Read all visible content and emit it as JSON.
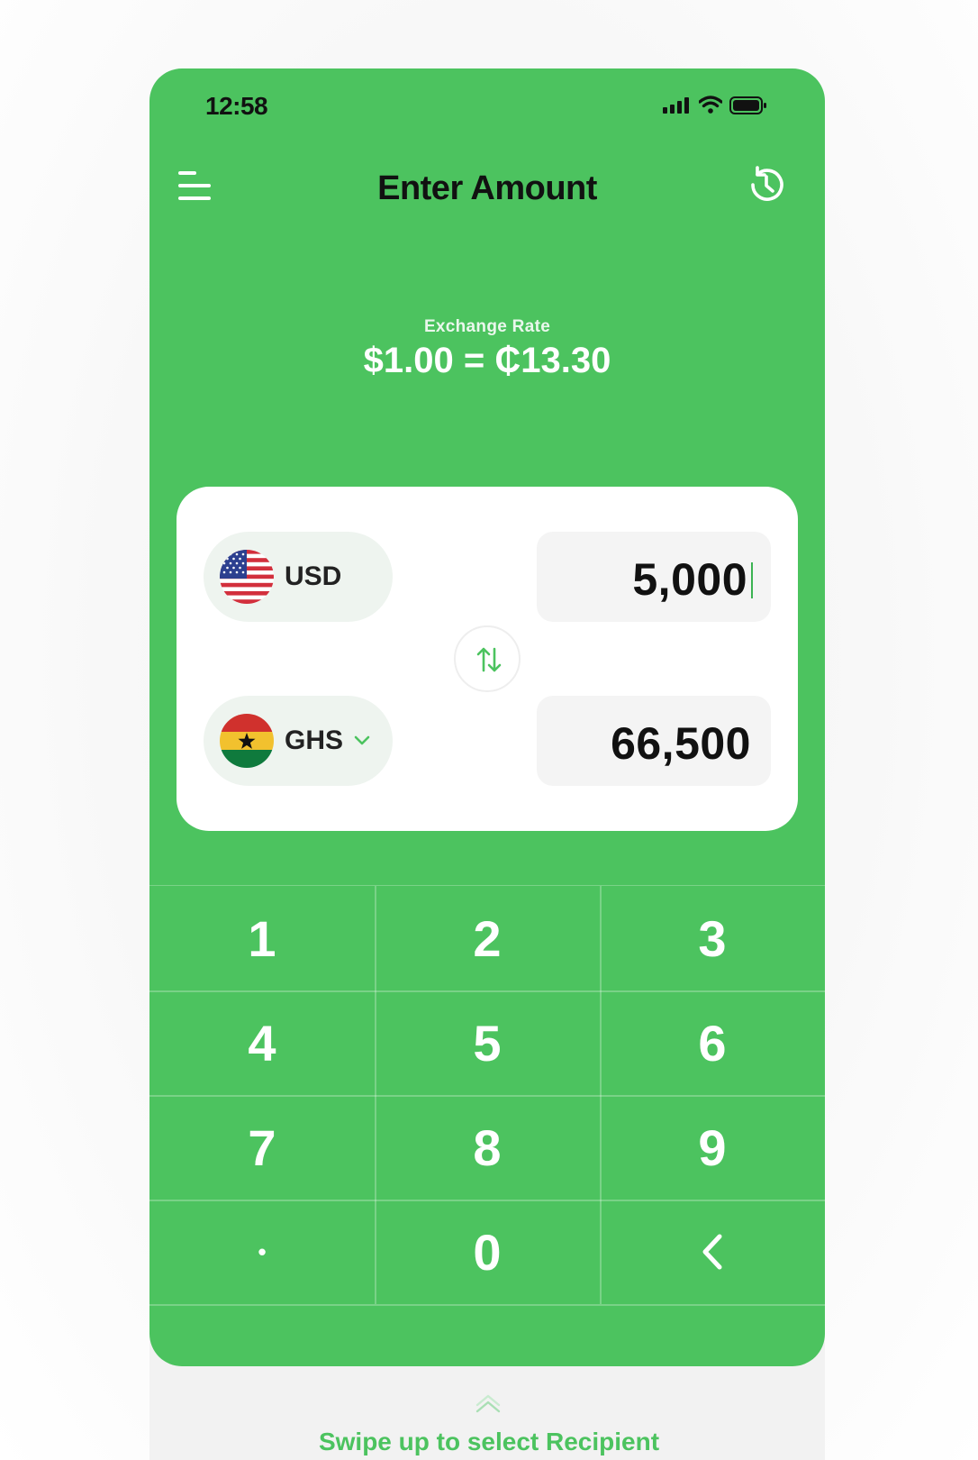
{
  "status_bar": {
    "time": "12:58"
  },
  "header": {
    "title": "Enter Amount"
  },
  "exchange": {
    "label": "Exchange Rate",
    "value": "$1.00 = ₵13.30"
  },
  "converter": {
    "from": {
      "code": "USD",
      "amount": "5,000"
    },
    "to": {
      "code": "GHS",
      "amount": "66,500"
    }
  },
  "keypad": {
    "keys": [
      "1",
      "2",
      "3",
      "4",
      "5",
      "6",
      "7",
      "8",
      "9",
      "•",
      "0",
      "<"
    ]
  },
  "footer": {
    "swipe_hint": "Swipe up to select Recipient"
  },
  "colors": {
    "brand_green": "#4cc35f",
    "card": "#ffffff",
    "pill": "#eef4ef"
  },
  "icons": [
    "menu-icon",
    "history-icon",
    "swap-icon",
    "chevron-down-icon",
    "backspace-icon",
    "chevron-up-icon"
  ]
}
